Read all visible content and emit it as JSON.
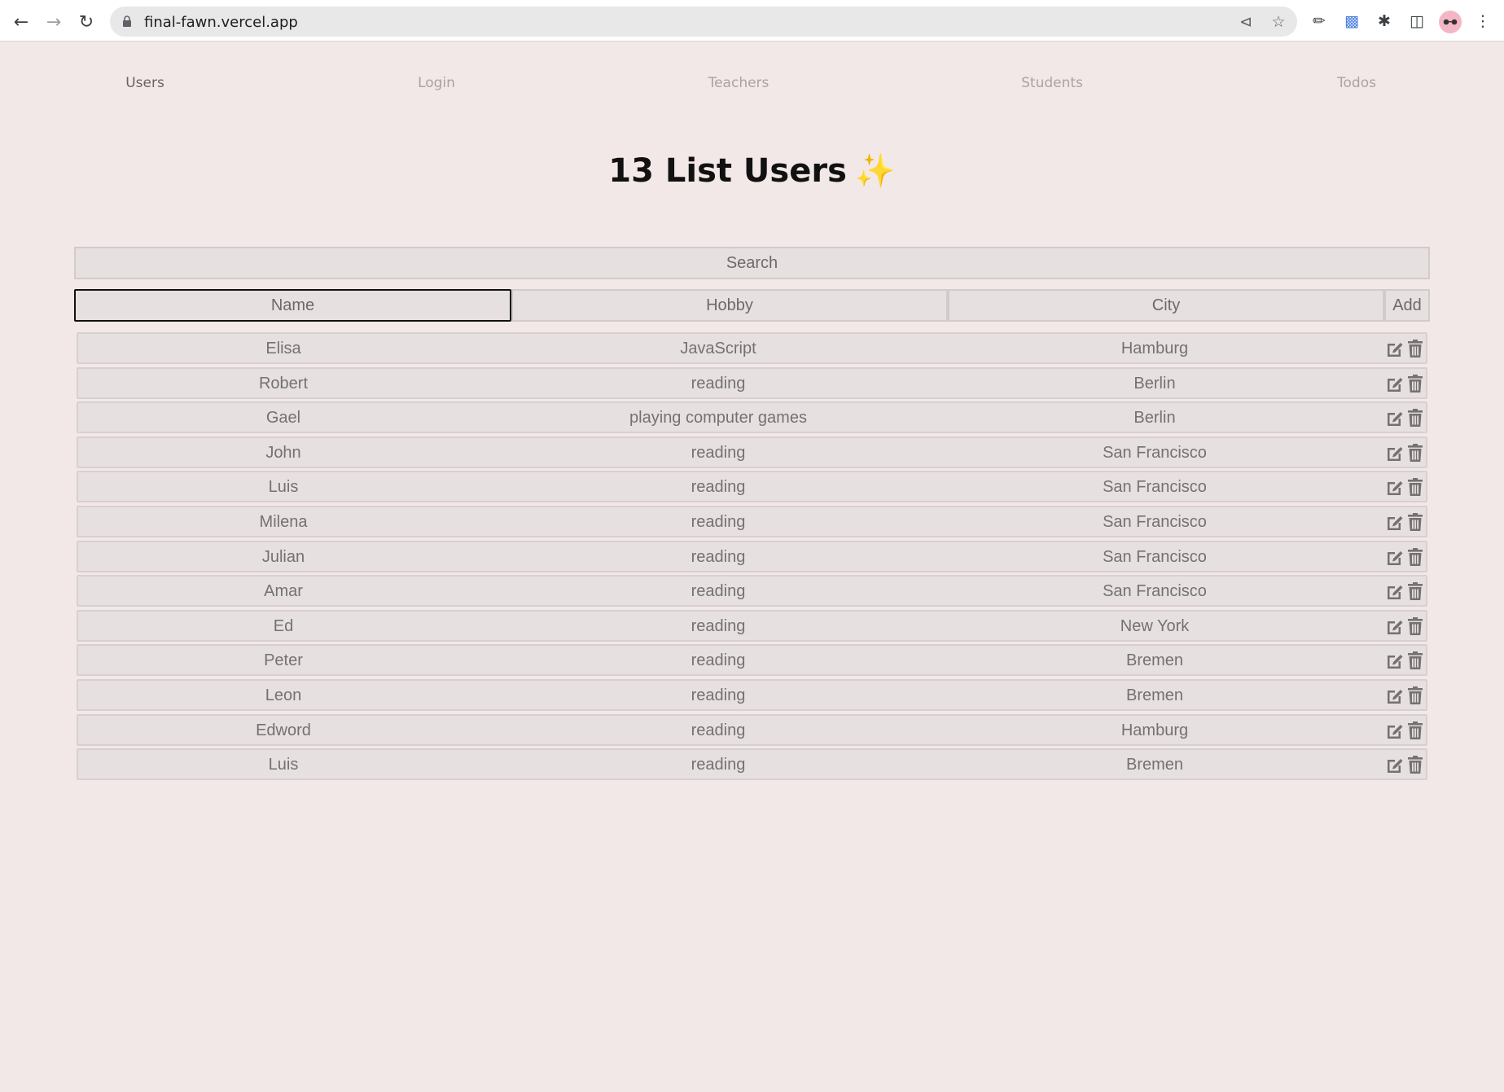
{
  "browser": {
    "url": "final-fawn.vercel.app"
  },
  "nav": {
    "items": [
      {
        "label": "Users",
        "active": true
      },
      {
        "label": "Login",
        "active": false
      },
      {
        "label": "Teachers",
        "active": false
      },
      {
        "label": "Students",
        "active": false
      },
      {
        "label": "Todos",
        "active": false
      }
    ]
  },
  "title": {
    "text": "13 List Users",
    "emoji": "✨"
  },
  "search": {
    "placeholder": "Search",
    "value": ""
  },
  "add_form": {
    "name_placeholder": "Name",
    "hobby_placeholder": "Hobby",
    "city_placeholder": "City",
    "add_label": "Add"
  },
  "users": [
    {
      "name": "Elisa",
      "hobby": "JavaScript",
      "city": "Hamburg"
    },
    {
      "name": "Robert",
      "hobby": "reading",
      "city": "Berlin"
    },
    {
      "name": "Gael",
      "hobby": "playing computer games",
      "city": "Berlin"
    },
    {
      "name": "John",
      "hobby": "reading",
      "city": "San Francisco"
    },
    {
      "name": "Luis",
      "hobby": "reading",
      "city": "San Francisco"
    },
    {
      "name": "Milena",
      "hobby": "reading",
      "city": "San Francisco"
    },
    {
      "name": "Julian",
      "hobby": "reading",
      "city": "San Francisco"
    },
    {
      "name": "Amar",
      "hobby": "reading",
      "city": "San Francisco"
    },
    {
      "name": "Ed",
      "hobby": "reading",
      "city": "New York"
    },
    {
      "name": "Peter",
      "hobby": "reading",
      "city": "Bremen"
    },
    {
      "name": "Leon",
      "hobby": "reading",
      "city": "Bremen"
    },
    {
      "name": "Edword",
      "hobby": "reading",
      "city": "Hamburg"
    },
    {
      "name": "Luis",
      "hobby": "reading",
      "city": "Bremen"
    }
  ],
  "icons": {
    "row_edit": "edit-icon",
    "row_delete": "trash-icon"
  },
  "colors": {
    "page_background": "#f2e8e7",
    "row_background": "#e6e1e0",
    "text_muted": "#767171",
    "nav_inactive": "#a9a3a3",
    "nav_active": "#6b6262"
  }
}
